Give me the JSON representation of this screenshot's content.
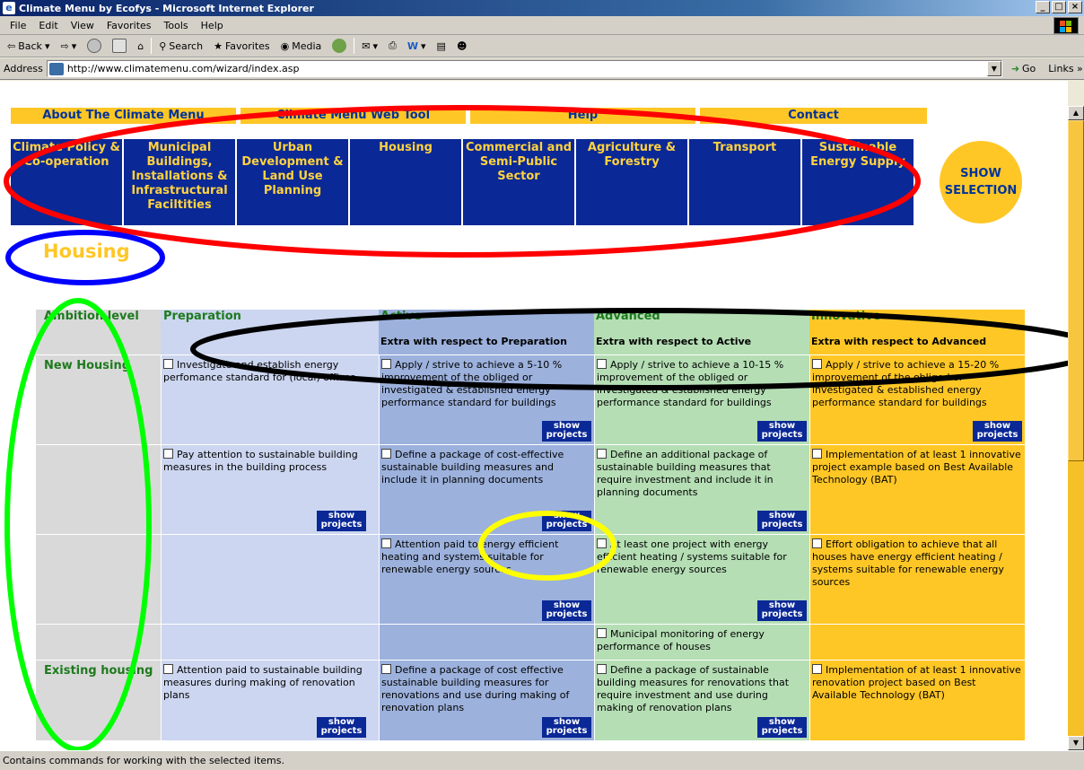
{
  "window": {
    "title": "Climate Menu by Ecofys - Microsoft Internet Explorer",
    "controls": [
      "_",
      "×"
    ]
  },
  "menubar": {
    "items": [
      "File",
      "Edit",
      "View",
      "Favorites",
      "Tools",
      "Help"
    ]
  },
  "toolbar": {
    "back": "Back",
    "search": "Search",
    "favorites": "Favorites",
    "media": "Media"
  },
  "address": {
    "label": "Address",
    "url": "http://www.climatemenu.com/wizard/index.asp",
    "go": "Go",
    "links": "Links"
  },
  "site_nav": [
    "About The Climate Menu",
    "Climate Menu Web Tool",
    "Help",
    "Contact"
  ],
  "sectors": [
    "Climate Policy & Co-operation",
    "Municipal Buildings, Installations & Infrastructural Faciltities",
    "Urban Development & Land Use Planning",
    "Housing",
    "Commercial and Semi-Public Sector",
    "Agriculture & Forestry",
    "Transport",
    "Sustainable Energy Supply"
  ],
  "show_selection": "SHOW SELECTION",
  "page_heading": "Housing",
  "table": {
    "col_headers": [
      "Ambition level",
      "Preparation",
      "Active",
      "Advanced",
      "Innovative"
    ],
    "sub_headers": [
      "",
      "",
      "Extra with respect to Preparation",
      "Extra with respect to Active",
      "Extra with respect to Advanced"
    ],
    "show_projects": "show projects",
    "row_labels": [
      "New Housing",
      "",
      "",
      "",
      "Existing housing"
    ],
    "cells": [
      [
        "Investigate and establish energy perfomance standard for (local) offices",
        "Apply / strive to achieve a 5-10 % improvement of the obliged or investigated & established energy performance standard for buildings",
        "Apply / strive to achieve a 10-15 % improvement of the obliged or investigated & established energy performance standard for buildings",
        "Apply / strive to achieve a 15-20 % improvement of the obliged or investigated & established energy performance standard for buildings"
      ],
      [
        "Pay attention to sustainable building measures in the building process",
        "Define a package of cost-effective sustainable building measures and include it in planning documents",
        "Define an additional package of sustainable building measures that require investment and include it in planning documents",
        "Implementation of at least 1 innovative project example based on Best Available Technology (BAT)"
      ],
      [
        "",
        "Attention paid to energy efficient heating and systems suitable for renewable energy sources",
        "At least one project with energy efficient heating / systems suitable for renewable energy sources",
        "Effort obligation to achieve that all houses have energy efficient heating / systems suitable for renewable energy sources"
      ],
      [
        "",
        "",
        "Municipal monitoring of energy performance of houses",
        ""
      ],
      [
        "Attention paid to sustainable building measures during making of renovation plans",
        "Define a package of cost effective sustainable building measures for renovations and use during making of renovation plans",
        "Define a package of sustainable building measures for renovations that require investment and use during making of renovation plans",
        "Implementation of at least 1 innovative renovation project based on Best Available Technology (BAT)"
      ]
    ]
  },
  "status": "Contains commands for working with the selected items.",
  "colors": {
    "nav_yellow": "#FFC726",
    "nav_blue": "#0A2896",
    "header_green": "#1E7A1E",
    "annotation_red": "#FF0000",
    "annotation_blue": "#0000FF",
    "annotation_black": "#000000",
    "annotation_green": "#00FF00",
    "annotation_yellow": "#FFFF00"
  }
}
